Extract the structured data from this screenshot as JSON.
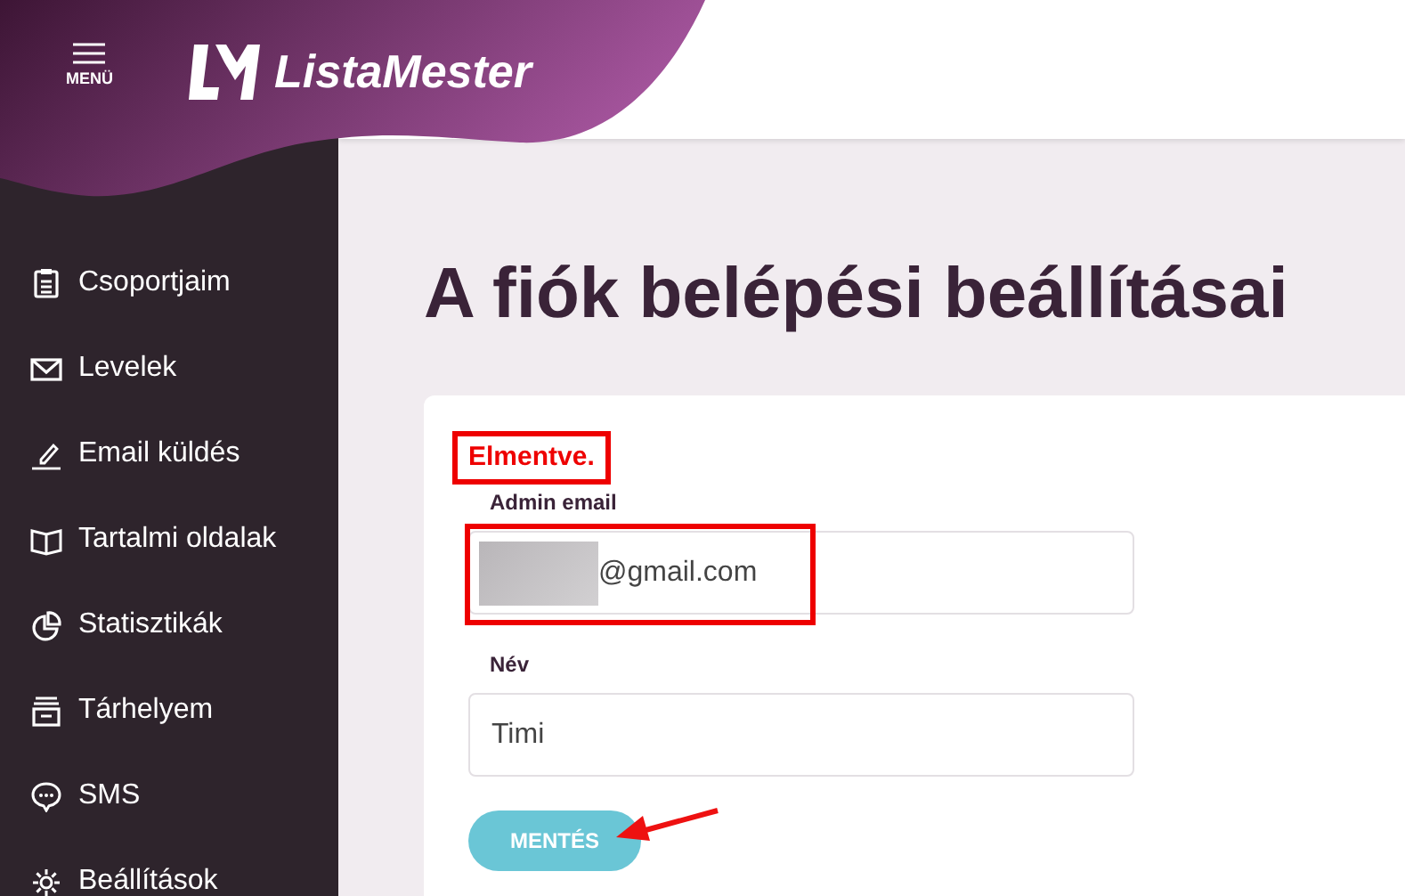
{
  "header": {
    "menu_label": "MENÜ",
    "brand": "ListaMester"
  },
  "sidebar": {
    "items": [
      {
        "label": "Csoportjaim"
      },
      {
        "label": "Levelek"
      },
      {
        "label": "Email küldés"
      },
      {
        "label": "Tartalmi oldalak"
      },
      {
        "label": "Statisztikák"
      },
      {
        "label": "Tárhelyem"
      },
      {
        "label": "SMS"
      },
      {
        "label": "Beállítások"
      }
    ]
  },
  "page_title": "A fiók belépési beállításai",
  "form": {
    "status_message": "Elmentve.",
    "fields": [
      {
        "label": "Admin email",
        "value": "@gmail.com",
        "redacted_prefix": true,
        "highlighted": true
      },
      {
        "label": "Név",
        "value": "Timi",
        "redacted_prefix": false,
        "highlighted": false
      }
    ],
    "save_button": "MENTÉS"
  }
}
